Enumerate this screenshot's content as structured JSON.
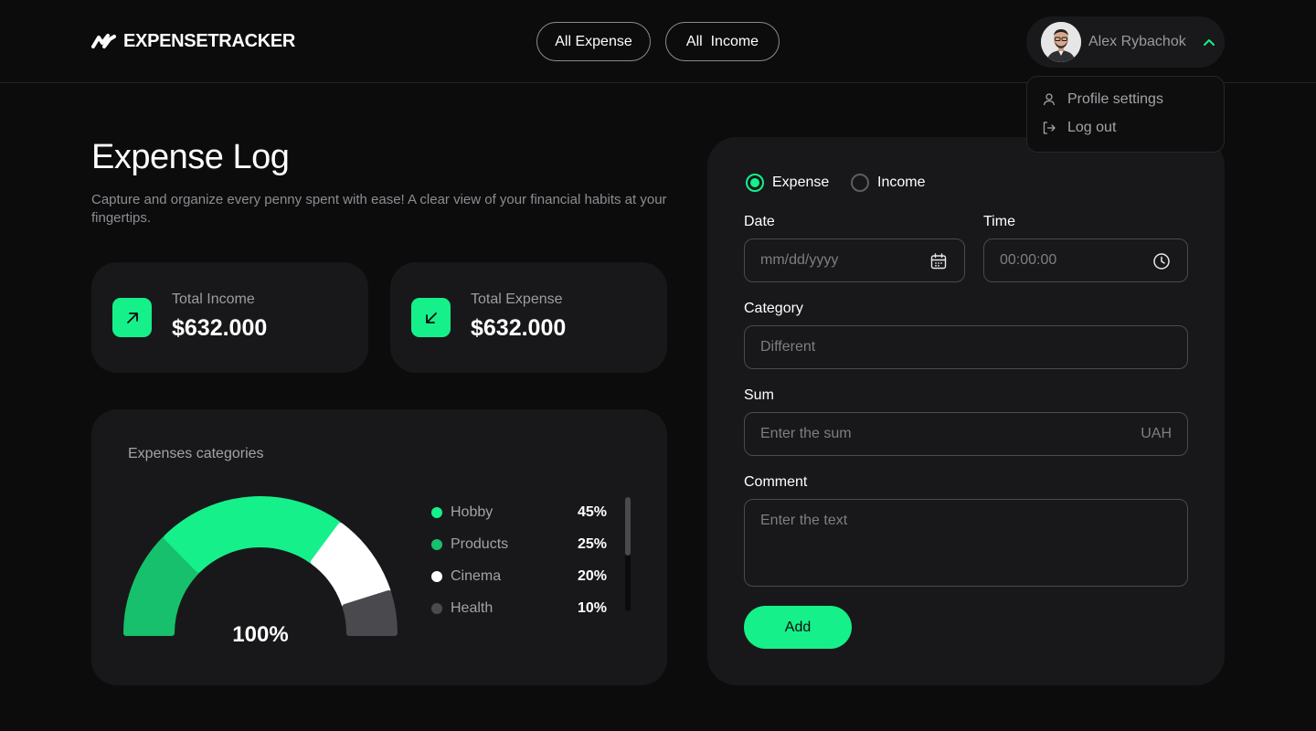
{
  "app": {
    "brand": "EXPENSETRACKER",
    "accent_color": "#16f08a"
  },
  "nav": {
    "all_expense": "All Expense",
    "all_income": "All  Income"
  },
  "user": {
    "name": "Alex Rybachok",
    "menu_open": true,
    "menu": [
      {
        "label": "Profile settings",
        "icon": "user-icon"
      },
      {
        "label": "Log out",
        "icon": "logout-icon"
      }
    ]
  },
  "page": {
    "title": "Expense Log",
    "subtitle": "Capture and organize every penny spent with ease! A clear view of your financial habits at your fingertips."
  },
  "stats": {
    "income": {
      "label": "Total Income",
      "value": "$632.000",
      "icon": "arrow-up-right-icon"
    },
    "expense": {
      "label": "Total Expense",
      "value": "$632.000",
      "icon": "arrow-down-left-icon"
    }
  },
  "categories": {
    "title": "Expenses categories",
    "total": "100%",
    "items": [
      {
        "name": "Hobby",
        "pct": "45%",
        "share": 0.45,
        "color": "#16f08a"
      },
      {
        "name": "Products",
        "pct": "25%",
        "share": 0.25,
        "color": "#17c06c"
      },
      {
        "name": "Cinema",
        "pct": "20%",
        "share": 0.2,
        "color": "#ffffff"
      },
      {
        "name": "Health",
        "pct": "10%",
        "share": 0.1,
        "color": "#4a4a4e"
      }
    ]
  },
  "form": {
    "type_options": [
      {
        "label": "Expense",
        "selected": true
      },
      {
        "label": "Income",
        "selected": false
      }
    ],
    "date": {
      "label": "Date",
      "placeholder": "mm/dd/yyyy",
      "icon": "calendar-icon"
    },
    "time": {
      "label": "Time",
      "placeholder": "00:00:00",
      "icon": "clock-icon"
    },
    "category": {
      "label": "Category",
      "value": "Different"
    },
    "sum": {
      "label": "Sum",
      "placeholder": "Enter the sum",
      "currency": "UAH"
    },
    "comment": {
      "label": "Comment",
      "placeholder": "Enter the text"
    },
    "submit_label": "Add"
  }
}
